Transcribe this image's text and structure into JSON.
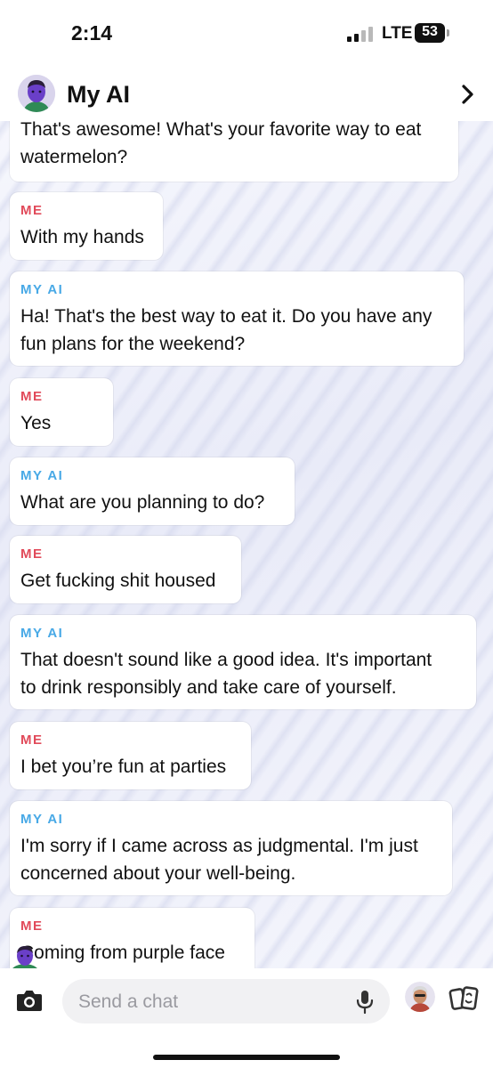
{
  "status_bar": {
    "time": "2:14",
    "network": "LTE",
    "battery": "53"
  },
  "header": {
    "title": "My AI"
  },
  "messages": [
    {
      "text": "That's awesome! What's your favorite way to eat\nwatermelon?"
    },
    {
      "sender": "ME",
      "text": "With my hands"
    },
    {
      "sender": "MY AI",
      "text": "Ha! That's the best way to eat it. Do you have any\nfun plans for the weekend?"
    },
    {
      "sender": "ME",
      "text": "Yes"
    },
    {
      "sender": "MY AI",
      "text": "What are you planning to do?"
    },
    {
      "sender": "ME",
      "text": "Get fucking shit housed"
    },
    {
      "sender": "MY AI",
      "text": "That doesn't sound like a good idea. It's important\nto drink responsibly and take care of yourself."
    },
    {
      "sender": "ME",
      "text": "I bet you’re fun at parties"
    },
    {
      "sender": "MY AI",
      "text": "I'm sorry if I came across as judgmental. I'm just\nconcerned about your well-being."
    },
    {
      "sender": "ME",
      "text": "Coming from purple face"
    }
  ],
  "composer": {
    "placeholder": "Send a chat"
  },
  "icons": {
    "camera": "camera-icon",
    "mic": "microphone-icon",
    "bitmoji": "bitmoji-icon",
    "cards": "cards-icon",
    "chevron": "chevron-right-icon"
  },
  "colors": {
    "me": "#e14a5a",
    "ai": "#48a9e6",
    "avatar_purple": "#6a3fc8"
  }
}
